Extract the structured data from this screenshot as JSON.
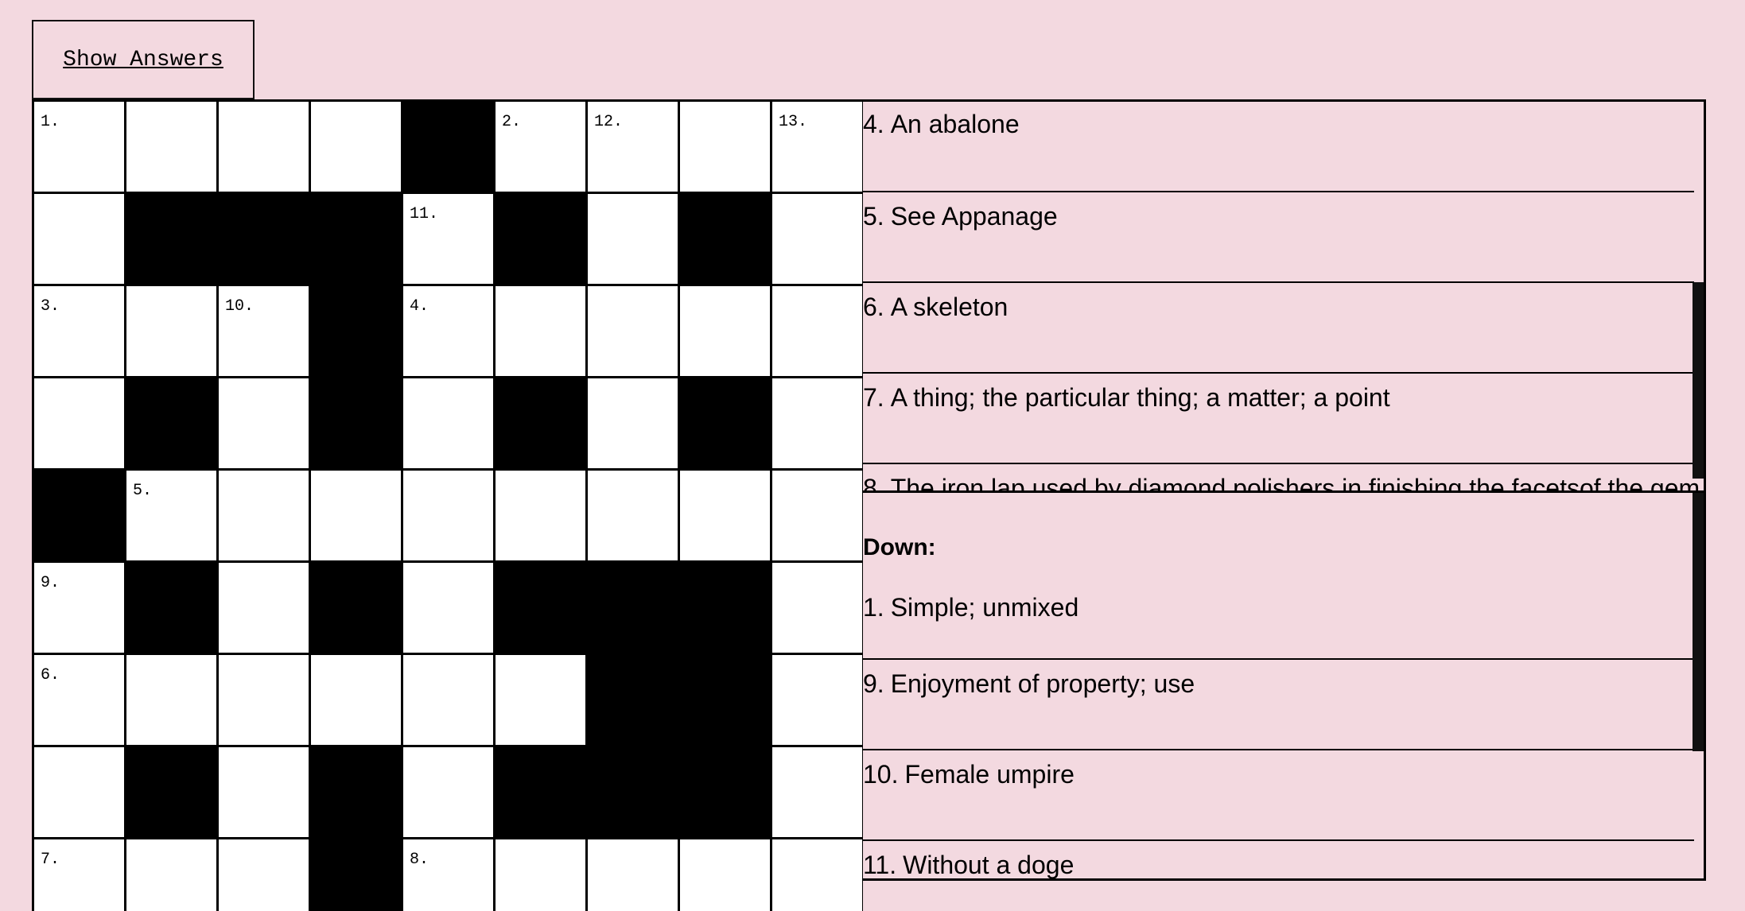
{
  "button": {
    "show_answers": "Show Answers"
  },
  "grid": {
    "rows": [
      [
        "n:1.",
        "w",
        "w",
        "w",
        "b",
        "n:2.",
        "n:12.",
        "w",
        "n:13."
      ],
      [
        "w",
        "b",
        "b",
        "b",
        "n:11.",
        "b",
        "w",
        "b",
        "w"
      ],
      [
        "n:3.",
        "w",
        "n:10.",
        "b",
        "n:4.",
        "w",
        "w",
        "w",
        "w"
      ],
      [
        "w",
        "b",
        "w",
        "b",
        "w",
        "b",
        "w",
        "b",
        "w"
      ],
      [
        "b",
        "n:5.",
        "w",
        "w",
        "w",
        "w",
        "w",
        "w",
        "w"
      ],
      [
        "n:9.",
        "b",
        "w",
        "b",
        "w",
        "b",
        "b",
        "b",
        "w"
      ],
      [
        "n:6.",
        "w",
        "w",
        "w",
        "w",
        "w",
        "b",
        "b",
        "w"
      ],
      [
        "w",
        "b",
        "w",
        "b",
        "w",
        "b",
        "b",
        "b",
        "w"
      ],
      [
        "n:7.",
        "w",
        "w",
        "b",
        "n:8.",
        "w",
        "w",
        "w",
        "w"
      ]
    ]
  },
  "across": {
    "clues": [
      {
        "num": "4.",
        "text": "An abalone"
      },
      {
        "num": "5.",
        "text": "See Appanage"
      },
      {
        "num": "6.",
        "text": "A skeleton"
      },
      {
        "num": "7.",
        "text": "A thing; the particular thing; a matter; a point"
      },
      {
        "num": "8.",
        "text": "The iron lap used by diamond polishers in finishing the facetsof the gem"
      }
    ]
  },
  "down": {
    "heading": "Down:",
    "clues": [
      {
        "num": "1.",
        "text": "Simple; unmixed"
      },
      {
        "num": "9.",
        "text": "Enjoyment of property; use"
      },
      {
        "num": "10.",
        "text": "Female umpire"
      },
      {
        "num": "11.",
        "text": "Without a doge"
      }
    ]
  }
}
